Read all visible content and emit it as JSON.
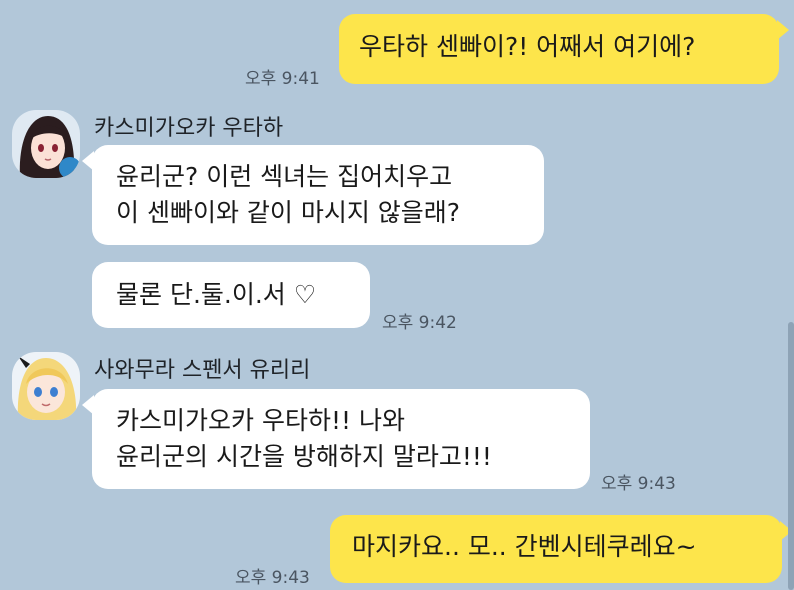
{
  "messages": [
    {
      "from": "me",
      "lines": [
        "우타하 센빠이?! 어째서 여기에?"
      ],
      "time": "오후 9:41"
    },
    {
      "from": "other",
      "sender": "카스미가오카 우타하",
      "lines": [
        "윤리군? 이런 섹녀는 집어치우고",
        "이 센빠이와 같이 마시지 않을래?"
      ],
      "time": ""
    },
    {
      "from": "other",
      "sender": "카스미가오카 우타하",
      "lines": [
        "물론 단.둘.이.서 ♡"
      ],
      "time": "오후 9:42"
    },
    {
      "from": "other",
      "sender": "사와무라 스펜서 유리리",
      "lines": [
        "카스미가오카 우타하!! 나와",
        "윤리군의 시간을 방해하지 말라고!!!"
      ],
      "time": "오후 9:43"
    },
    {
      "from": "me",
      "lines": [
        "마지카요.. 모.. 간벤시테쿠레요~"
      ],
      "time": "오후 9:43"
    }
  ],
  "colors": {
    "background": "#b2c7d9",
    "my_bubble": "#fde54b",
    "other_bubble": "#ffffff"
  },
  "icons": {
    "avatar_1": "avatar-dark-haired-girl",
    "avatar_2": "avatar-blonde-girl"
  }
}
